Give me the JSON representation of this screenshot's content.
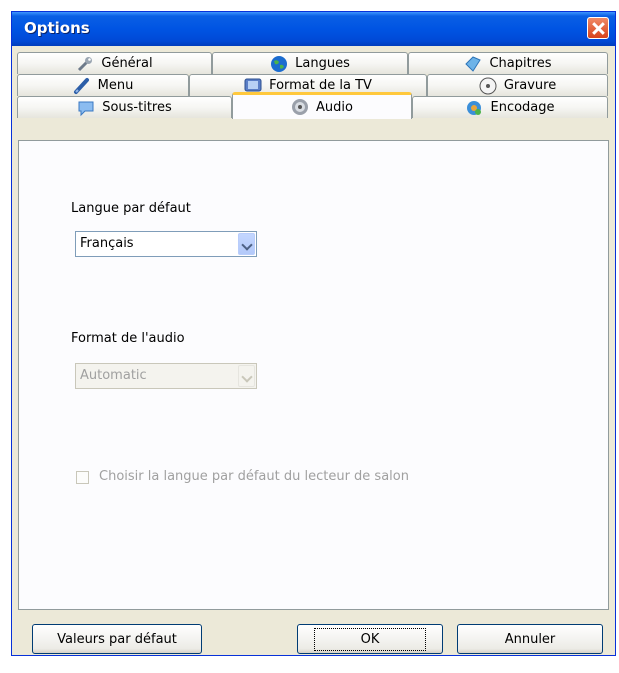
{
  "window": {
    "title": "Options"
  },
  "tabs": [
    {
      "label": "Général"
    },
    {
      "label": "Langues"
    },
    {
      "label": "Chapitres"
    },
    {
      "label": "Menu"
    },
    {
      "label": "Format de la TV"
    },
    {
      "label": "Gravure"
    },
    {
      "label": "Sous-titres"
    },
    {
      "label": "Audio",
      "active": true
    },
    {
      "label": "Encodage"
    }
  ],
  "audio": {
    "default_language_label": "Langue par défaut",
    "default_language_value": "Français",
    "audio_format_label": "Format de l'audio",
    "audio_format_value": "Automatic",
    "salon_checkbox_label": "Choisir la langue par défaut du lecteur de salon",
    "salon_checkbox_checked": false
  },
  "buttons": {
    "defaults": "Valeurs par défaut",
    "ok": "OK",
    "cancel": "Annuler"
  },
  "colors": {
    "title_bar": "#0054e3",
    "active_tab_accent": "#ffc83c",
    "face": "#ece9d8"
  }
}
